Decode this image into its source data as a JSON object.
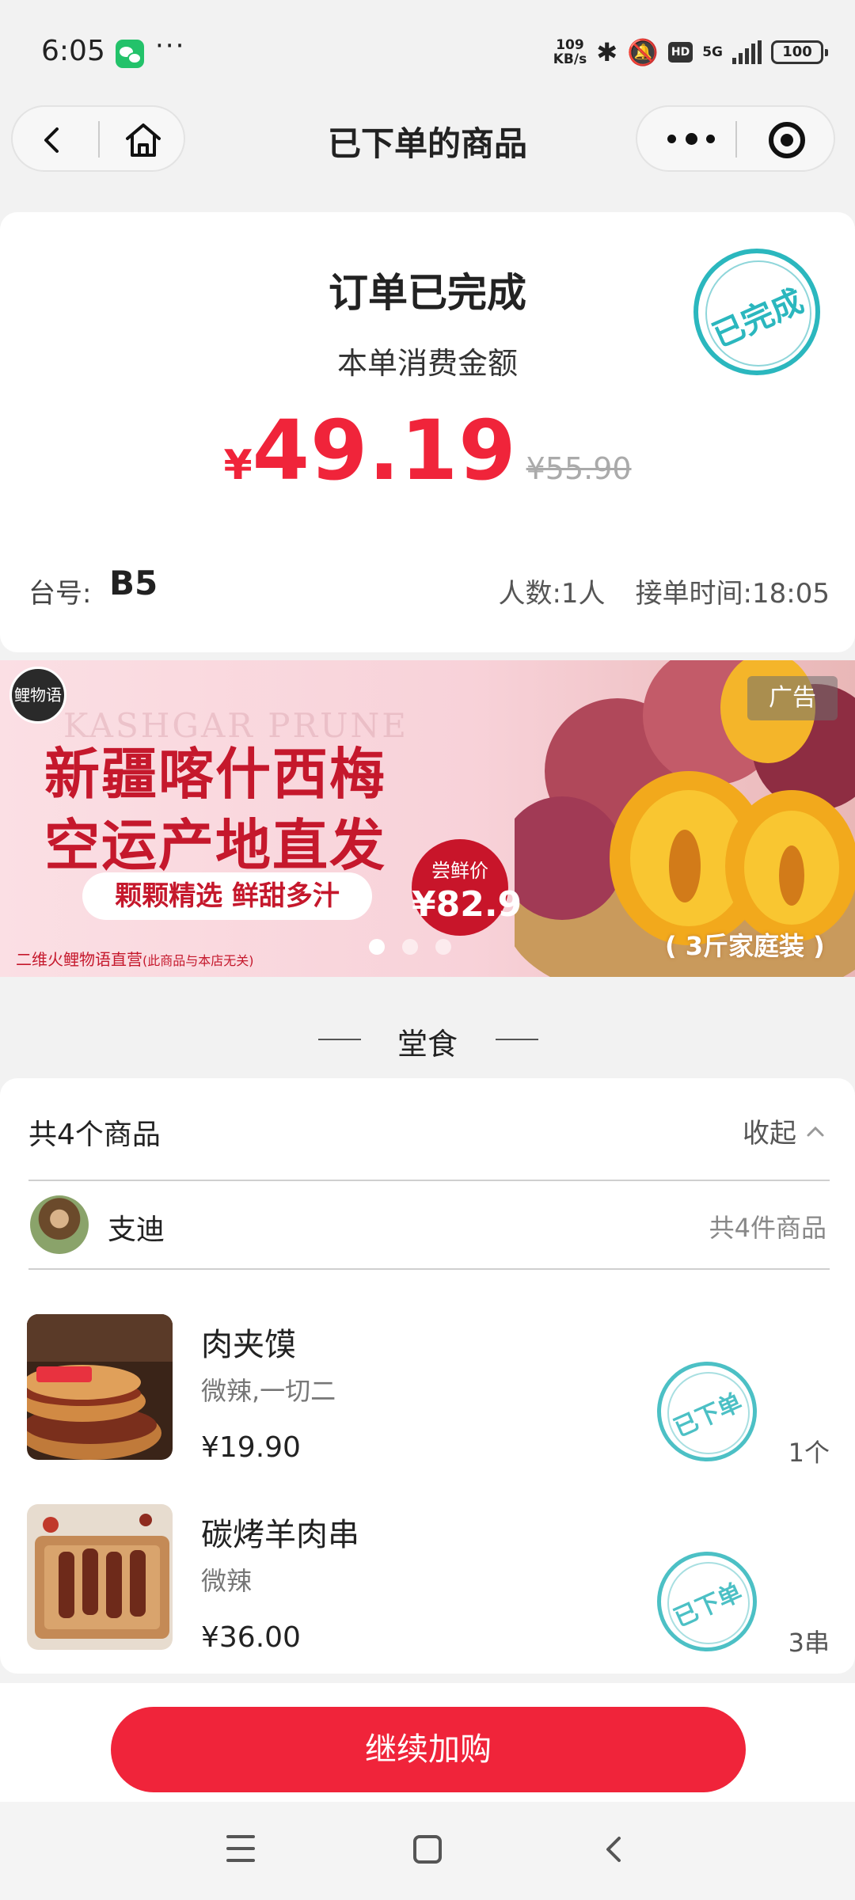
{
  "status_bar": {
    "time": "6:05",
    "more": "···",
    "speed_top": "109",
    "speed_bottom": "KB/s",
    "bluetooth": "✱",
    "mute": "🔕",
    "hd": "HD",
    "network": "5G",
    "battery": "100"
  },
  "nav": {
    "title": "已下单的商品",
    "back_icon": "chevron-left-icon",
    "home_icon": "home-icon",
    "more_icon": "more-dots-icon",
    "close_icon": "target-circle-icon"
  },
  "order": {
    "status": "订单已完成",
    "amount_label": "本单消费金额",
    "currency": "¥",
    "amount": "49.19",
    "original_amount": "¥55.90",
    "stamp": "已完成",
    "table_label": "台号:",
    "table_value": "B5",
    "people": "人数:1人",
    "accept_time": "接单时间:18:05"
  },
  "ad": {
    "logo": "鲤物语",
    "watermark": "KASHGAR PRUNE",
    "line1": "新疆喀什西梅",
    "line2": "空运产地直发",
    "slogan": "颗颗精选  鲜甜多汁",
    "badge_top": "尝鲜价",
    "badge_price": "¥82.9",
    "source": "二维火鲤物语直营",
    "source_note": "(此商品与本店无关)",
    "tag": "广告",
    "pack": "( 3斤家庭装 )",
    "slides": 3,
    "active_slide": 0
  },
  "section": {
    "title": "堂食"
  },
  "goods": {
    "count_label": "共4个商品",
    "collapse_label": "收起",
    "user_name": "支迪",
    "user_count": "共4件商品",
    "items": [
      {
        "name": "肉夹馍",
        "spec": "微辣,一切二",
        "price": "¥19.90",
        "stamp": "已下单",
        "qty": "1个"
      },
      {
        "name": "碳烤羊肉串",
        "spec": "微辣",
        "price": "¥36.00",
        "stamp": "已下单",
        "qty": "3串"
      }
    ]
  },
  "bottom": {
    "continue_label": "继续加购"
  },
  "colors": {
    "accent": "#f0243a",
    "stamp": "#2bb7be",
    "background": "#f2f2f2"
  }
}
